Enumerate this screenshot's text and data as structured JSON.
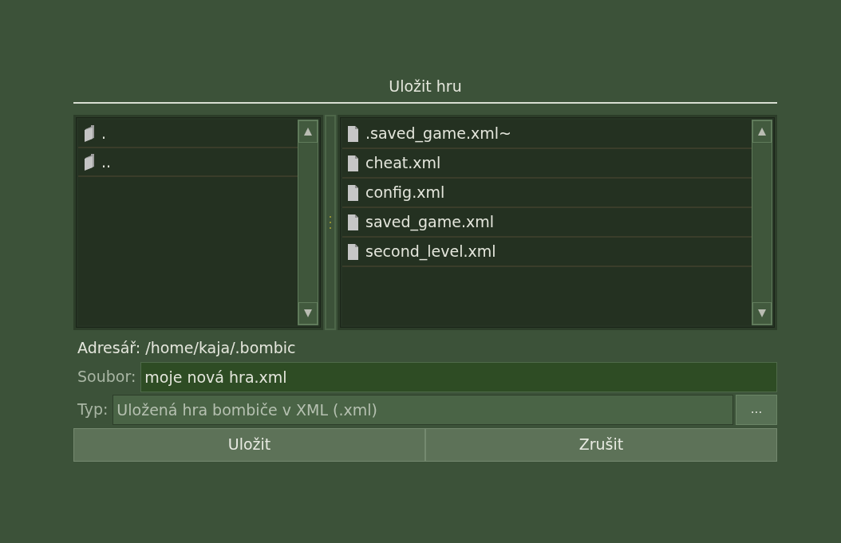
{
  "dialog": {
    "title": "Uložit hru"
  },
  "directories": [
    {
      "name": "."
    },
    {
      "name": ".."
    }
  ],
  "files": [
    {
      "name": ".saved_game.xml~"
    },
    {
      "name": "cheat.xml"
    },
    {
      "name": "config.xml"
    },
    {
      "name": "saved_game.xml"
    },
    {
      "name": "second_level.xml"
    }
  ],
  "directory": {
    "label": "Adresář:",
    "value": "/home/kaja/.bombic"
  },
  "file_field": {
    "label": "Soubor:",
    "value": "moje nová hra.xml"
  },
  "type_field": {
    "label": "Typ:",
    "value": "Uložená hra bombiče v XML (.xml)",
    "button": "..."
  },
  "buttons": [
    "Uložit",
    "Zrušit"
  ]
}
